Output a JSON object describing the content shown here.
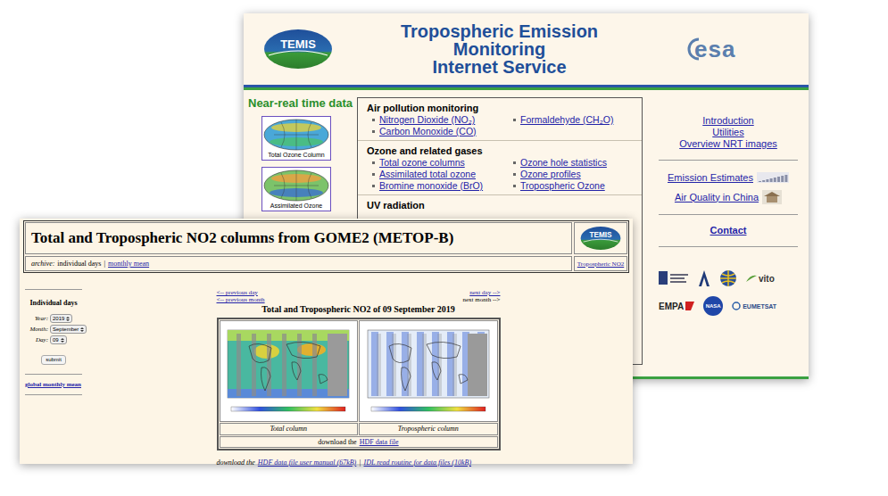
{
  "back_page": {
    "logo": "TEMIS",
    "title_lines": [
      "Tropospheric Emission",
      "Monitoring",
      "Internet Service"
    ],
    "esa_logo": "esa",
    "nrt": {
      "heading": "Near-real time data",
      "thumbnails": [
        {
          "caption": "Total Ozone Column"
        },
        {
          "caption": "Assimilated Ozone"
        }
      ]
    },
    "sections": [
      {
        "heading": "Air pollution monitoring",
        "columns": [
          [
            "Nitrogen Dioxide (NO₂)",
            "Carbon Monoxide (CO)"
          ],
          [
            "Formaldehyde (CH₂O)"
          ]
        ]
      },
      {
        "heading": "Ozone and related gases",
        "columns": [
          [
            "Total ozone columns",
            "Assimilated total ozone",
            "Bromine monoxide (BrO)"
          ],
          [
            "Ozone hole statistics",
            "Ozone profiles",
            "Tropospheric Ozone"
          ]
        ]
      },
      {
        "heading": "UV radiation",
        "columns": []
      }
    ],
    "side_links": [
      {
        "label": "Introduction"
      },
      {
        "label": "Utilities"
      },
      {
        "label": "Overview NRT images"
      }
    ],
    "feature_links": [
      {
        "label": "Emission Estimates",
        "kind": "chart"
      },
      {
        "label": "Air Quality in China",
        "kind": "photo"
      }
    ],
    "contact": "Contact",
    "partners": [
      [
        {
          "kind": "crest"
        },
        {
          "kind": "arrow"
        },
        {
          "kind": "globe"
        },
        {
          "kind": "leaf",
          "label": "vito"
        }
      ],
      [
        {
          "kind": "flag",
          "label": "EMPA"
        },
        {
          "kind": "meatball",
          "label": "NASA"
        },
        {
          "kind": "swirl",
          "label": "EUMETSAT"
        }
      ]
    ]
  },
  "front_page": {
    "title": "Total and Tropospheric NO2 columns from GOME2 (METOP-B)",
    "logo": "TEMIS",
    "corner_link": "Tropospheric NO2",
    "archive": {
      "label": "archive:",
      "separator": "|",
      "views": [
        {
          "label": "individual days",
          "selected": true
        },
        {
          "label": "monthly mean",
          "selected": false
        }
      ]
    },
    "form": {
      "heading": "Individual days",
      "fields": [
        {
          "label": "Year:",
          "value": "2019"
        },
        {
          "label": "Month:",
          "value": "September"
        },
        {
          "label": "Day:",
          "value": "09"
        }
      ],
      "submit": "submit"
    },
    "monthly_link": "global monthly mean",
    "nav_left": [
      {
        "label": "<-- previous day",
        "link": true
      },
      {
        "label": "<-- previous month",
        "link": true
      }
    ],
    "nav_right": [
      {
        "label": "next day -->",
        "link": true
      },
      {
        "label": "next month -->",
        "link": false
      }
    ],
    "day_title": "Total and Tropospheric NO2 of 09 September 2019",
    "maps": [
      {
        "caption": "Total column",
        "kind": "total"
      },
      {
        "caption": "Tropospheric column",
        "kind": "tropospheric"
      }
    ],
    "hdf": {
      "prefix": "download the",
      "link": "HDF data file"
    },
    "footer": {
      "prefix": "download the",
      "separator": "|",
      "links": [
        "HDF data file user manual (67kB)",
        "IDL read routine for data files (10kB)"
      ]
    }
  }
}
